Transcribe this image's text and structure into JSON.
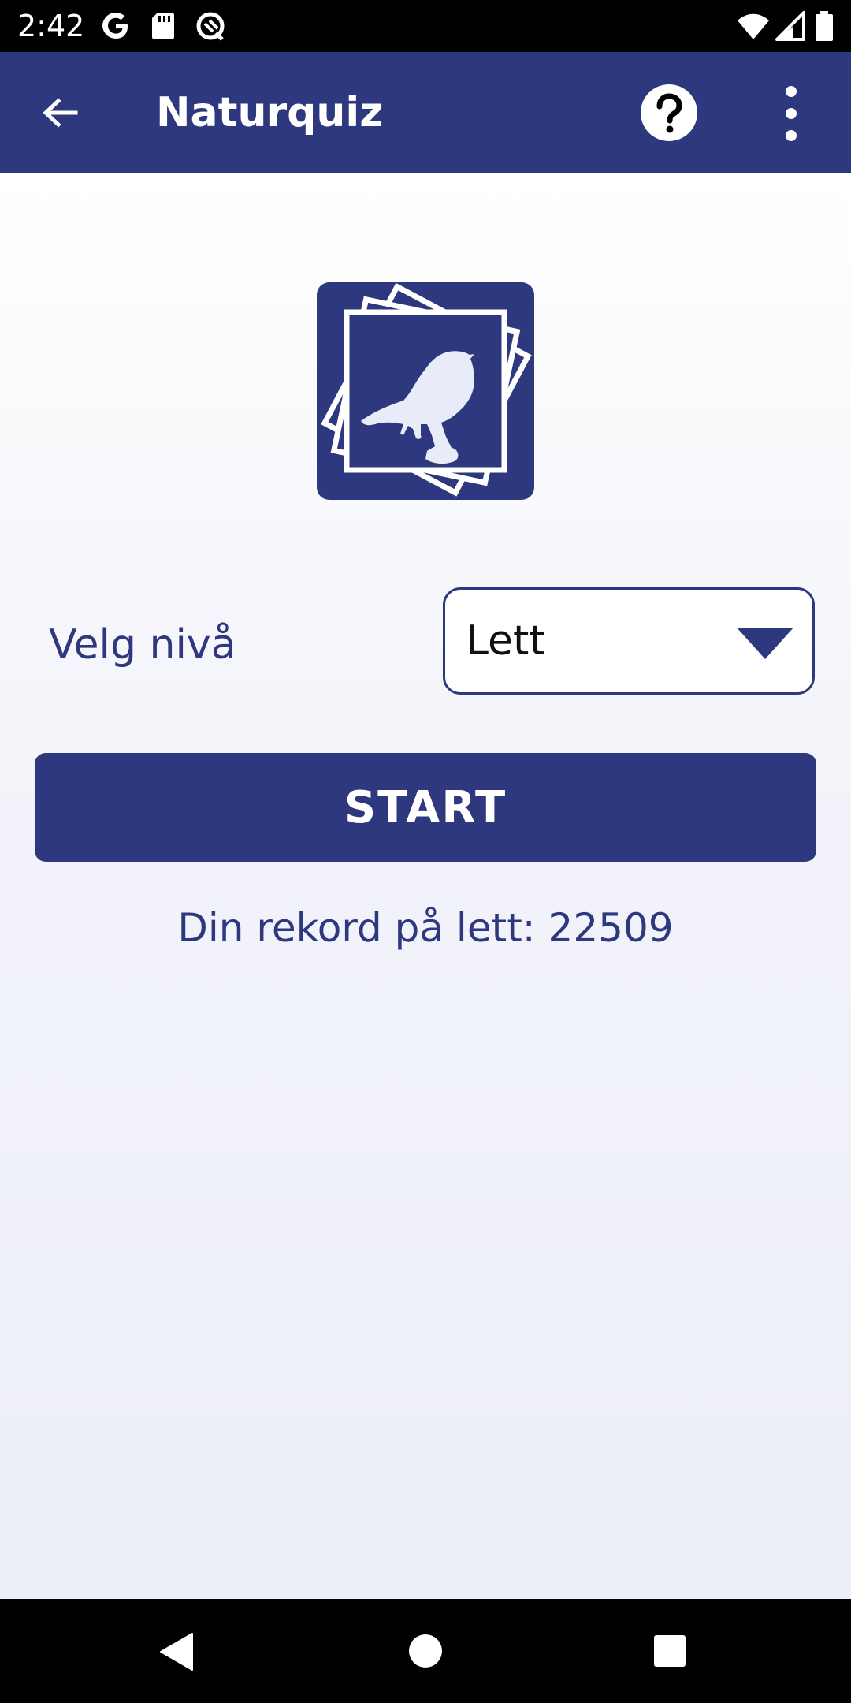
{
  "status_bar": {
    "time": "2:42",
    "icons": [
      "google-icon",
      "sd-card-icon",
      "data-saver-icon",
      "wifi-icon",
      "cell-signal-icon",
      "battery-icon"
    ]
  },
  "app_bar": {
    "title": "Naturquiz",
    "back_icon": "arrow-back-icon",
    "help_icon": "help-circle-icon",
    "more_icon": "more-vert-icon"
  },
  "colors": {
    "primary": "#2d387e",
    "on_primary": "#ffffff",
    "logo_bird": "#e8ebf8"
  },
  "main": {
    "logo_icon": "bird-photo-stack-icon",
    "level_label": "Velg nivå",
    "level_selected": "Lett",
    "start_label": "START",
    "record_text": "Din rekord på lett: 22509"
  },
  "nav_bar": {
    "icons": [
      "nav-back-icon",
      "nav-home-icon",
      "nav-recents-icon"
    ]
  }
}
